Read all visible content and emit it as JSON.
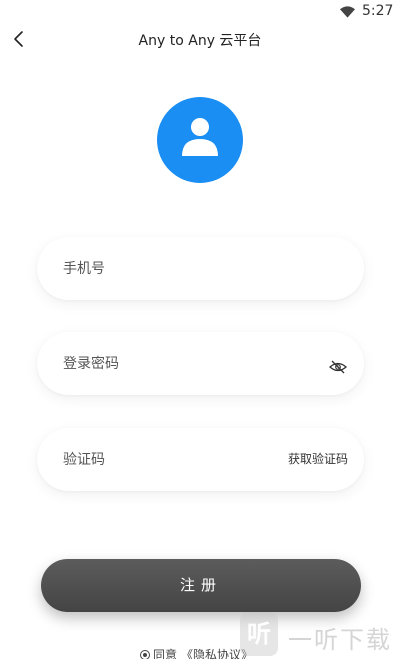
{
  "status_bar": {
    "time": "5:27"
  },
  "header": {
    "title": "Any to Any 云平台"
  },
  "form": {
    "phone_placeholder": "手机号",
    "password_placeholder": "登录密码",
    "code_placeholder": "验证码",
    "get_code_label": "获取验证码"
  },
  "register_button": "注册",
  "agreement": {
    "prefix": "同意",
    "link": "《隐私协议》"
  },
  "watermark": {
    "logo": "听",
    "text": "一听下载"
  },
  "colors": {
    "avatar_bg": "#1a8ef2",
    "button_bg": "#4f4f4f"
  }
}
